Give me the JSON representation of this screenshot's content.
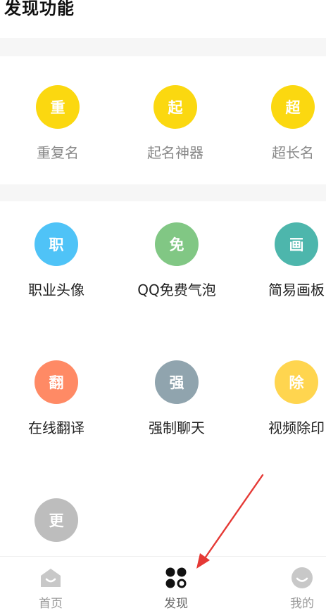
{
  "header": {
    "title": "发现功能"
  },
  "features": [
    {
      "label": "重复名",
      "glyph": "重",
      "color": "#fbd810"
    },
    {
      "label": "起名神器",
      "glyph": "起",
      "color": "#fbd810"
    },
    {
      "label": "超长名",
      "glyph": "超",
      "color": "#fbd810"
    },
    {
      "label": "职业头像",
      "glyph": "职",
      "color": "#4fc3f7"
    },
    {
      "label": "QQ免费气泡",
      "glyph": "免",
      "color": "#81c784"
    },
    {
      "label": "简易画板",
      "glyph": "画",
      "color": "#4db6ac"
    },
    {
      "label": "在线翻译",
      "glyph": "翻",
      "color": "#ff8a65"
    },
    {
      "label": "强制聊天",
      "glyph": "强",
      "color": "#90a4ae"
    },
    {
      "label": "视频除印",
      "glyph": "除",
      "color": "#ffd54f"
    },
    {
      "label": "",
      "glyph": "更",
      "color": "#bdbdbd"
    }
  ],
  "nav": {
    "home": {
      "label": "首页",
      "icon": "home-icon"
    },
    "discover": {
      "label": "发现",
      "icon": "grid-icon"
    },
    "mine": {
      "label": "我的",
      "icon": "smile-icon"
    }
  },
  "annotation": {
    "arrow_color": "#e53935"
  }
}
